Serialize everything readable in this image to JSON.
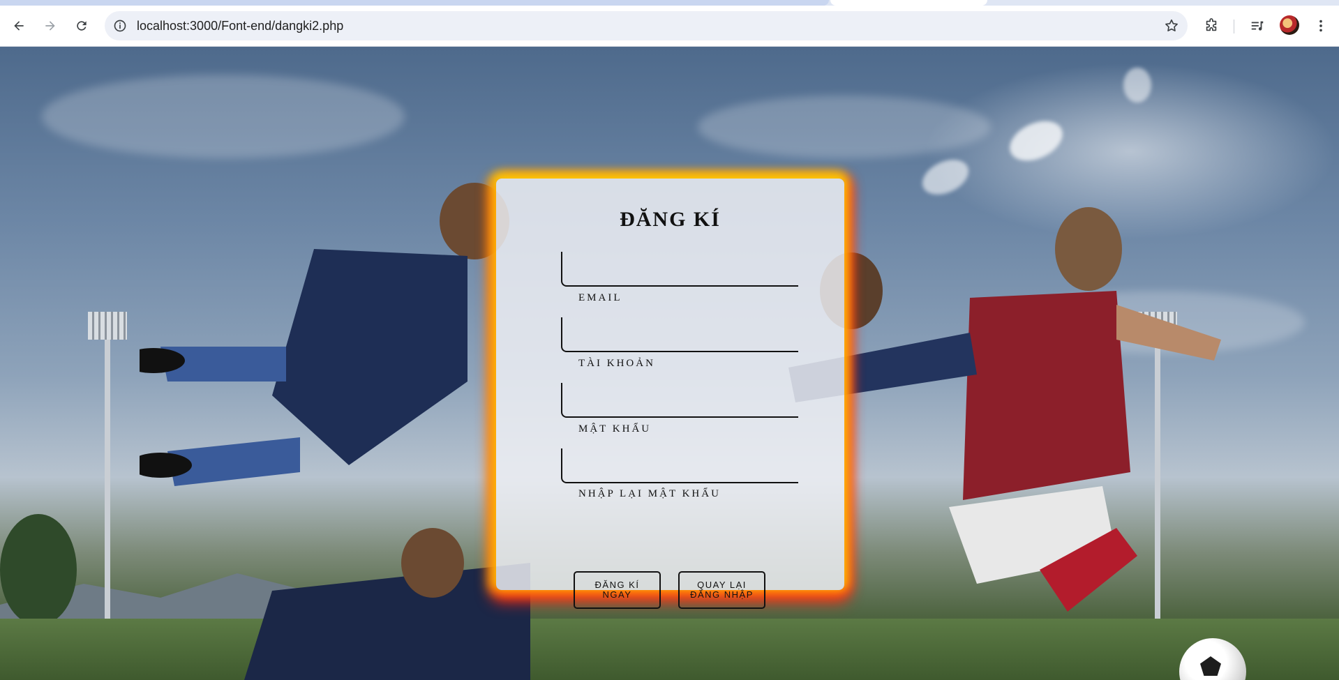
{
  "browser": {
    "url": "localhost:3000/Font-end/dangki2.php",
    "icons": {
      "back": "arrow-left-icon",
      "forward": "arrow-right-icon",
      "reload": "reload-icon",
      "site_info": "info-icon",
      "bookmark": "star-icon",
      "extensions": "puzzle-icon",
      "media": "media-control-icon",
      "menu": "kebab-menu-icon"
    }
  },
  "form": {
    "title": "ĐĂNG KÍ",
    "fields": [
      {
        "label": "",
        "value": ""
      },
      {
        "label": "EMAIL",
        "value": ""
      },
      {
        "label": "TÀI KHOẢN",
        "value": ""
      },
      {
        "label": "MẬT KHẨU",
        "value": ""
      }
    ],
    "last_label": "NHẬP LẠI MẬT KHẨU",
    "buttons": {
      "register": "ĐĂNG KÍ NGAY",
      "back_to_login": "QUAY LẠI ĐĂNG NHẬP"
    }
  },
  "colors": {
    "glow_top": "#ffd700",
    "glow_bottom": "#ff2814"
  }
}
